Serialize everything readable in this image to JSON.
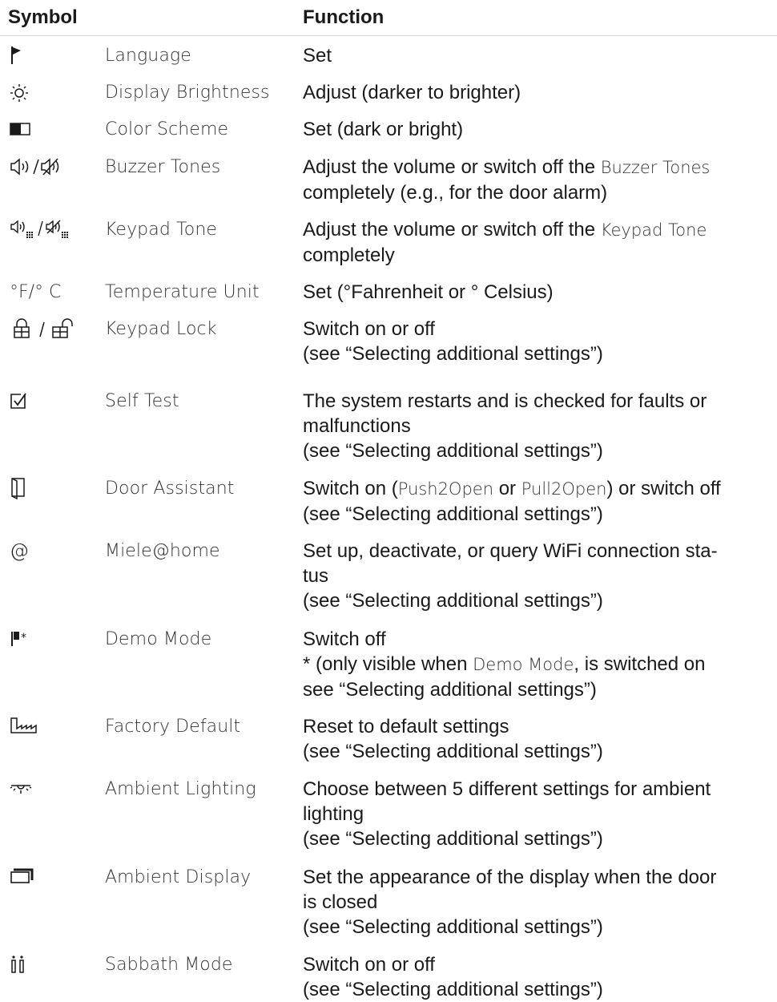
{
  "header": {
    "symbol": "Symbol",
    "function": "Function"
  },
  "rows": [
    {
      "icon": "flag-icon",
      "symbol_text": "",
      "name": "Language",
      "lines": [
        "Set"
      ]
    },
    {
      "icon": "brightness-icon",
      "symbol_text": "",
      "name": "Display Brightness",
      "lines": [
        "Adjust (darker to brighter)"
      ]
    },
    {
      "icon": "color-scheme-icon",
      "symbol_text": "",
      "name": "Color Scheme",
      "lines": [
        "Set (dark or bright)"
      ]
    },
    {
      "icon": "speaker-icon",
      "symbol_text": "",
      "name": "Buzzer Tones",
      "fn_a": "Adjust the volume or switch off the ",
      "fn_name": "Buzzer Tones",
      "fn_b": "completely (e.g., for the door alarm)"
    },
    {
      "icon": "keypad-speaker-icon",
      "symbol_text": "",
      "name": "Keypad Tone",
      "fn_a": "Adjust the volume or switch off the ",
      "fn_name": "Keypad Tone",
      "fn_b": "completely"
    },
    {
      "icon": "temperature-unit-icon",
      "symbol_text": "°F/° C",
      "name": "Temperature Unit",
      "lines": [
        "Set (°Fahrenheit or ° Celsius)"
      ]
    },
    {
      "icon": "lock-icon",
      "symbol_text": "",
      "name": "Keypad Lock",
      "lines": [
        "Switch on or off",
        "(see “Selecting additional settings”)"
      ]
    },
    {
      "icon": "checkbox-icon",
      "symbol_text": "",
      "name": "Self Test",
      "lines": [
        "The system restarts and is checked for faults or",
        "malfunctions",
        "(see “Selecting additional settings”)"
      ]
    },
    {
      "icon": "door-icon",
      "symbol_text": "",
      "name": "Door Assistant",
      "fn_a": "Switch on (",
      "fn_p1": "Push2Open",
      "fn_or": " or ",
      "fn_p2": "Pull2Open",
      "fn_end": ") or switch off",
      "fn_b": "(see “Selecting additional settings”)"
    },
    {
      "icon": "at-icon",
      "symbol_text": "@",
      "name": "Miele@home",
      "lines": [
        "Set up, deactivate, or query WiFi connection sta-",
        "tus",
        "(see “Selecting additional settings”)"
      ]
    },
    {
      "icon": "demo-flag-icon",
      "symbol_text": "",
      "name": "Demo Mode",
      "fn_first": "Switch off",
      "fn_a": "* (only visible when ",
      "fn_name": "Demo Mode",
      "fn_mid": ", is switched on",
      "fn_b": "see “Selecting additional settings”)"
    },
    {
      "icon": "factory-icon",
      "symbol_text": "",
      "name": "Factory Default",
      "lines": [
        "Reset to default settings",
        "(see “Selecting additional settings”)"
      ]
    },
    {
      "icon": "ambient-light-icon",
      "symbol_text": "",
      "name": "Ambient Lighting",
      "lines": [
        "Choose between 5 different settings for ambient",
        "lighting",
        "(see “Selecting additional settings”)"
      ]
    },
    {
      "icon": "ambient-display-icon",
      "symbol_text": "",
      "name": "Ambient Display",
      "lines": [
        "Set the appearance of the display when the door",
        "is closed",
        "(see “Selecting additional settings”)"
      ]
    },
    {
      "icon": "sabbath-icon",
      "symbol_text": "",
      "name": "Sabbath Mode",
      "lines": [
        "Switch on or off",
        "(see “Selecting additional settings”)"
      ]
    }
  ]
}
